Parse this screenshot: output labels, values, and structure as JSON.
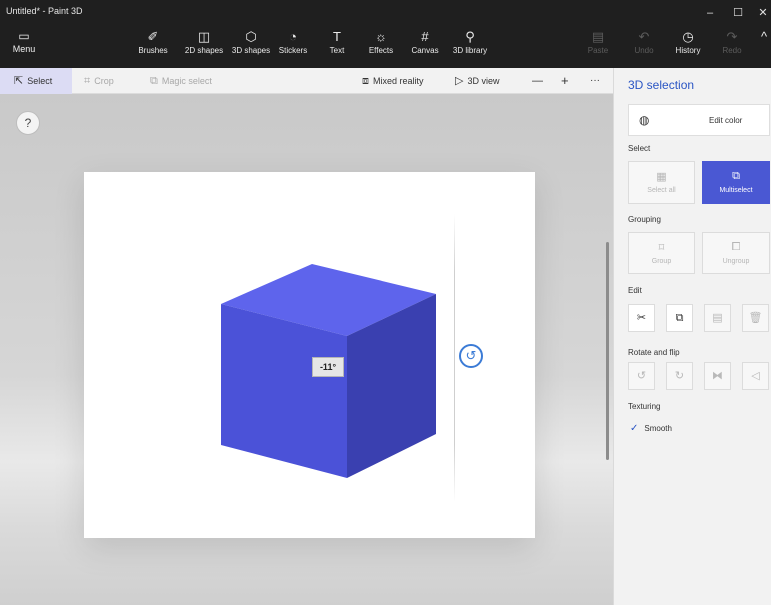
{
  "window": {
    "title": "Untitled* - Paint 3D",
    "minimize_icon": "minimize-icon",
    "maximize_icon": "maximize-icon",
    "close_icon": "close-icon"
  },
  "ribbon": {
    "menu_label": "Menu",
    "tools": [
      {
        "label": "Brushes",
        "icon": "brush-icon"
      },
      {
        "label": "2D shapes",
        "icon": "2d-shapes-icon"
      },
      {
        "label": "3D shapes",
        "icon": "3d-shapes-icon"
      },
      {
        "label": "Stickers",
        "icon": "stickers-icon"
      },
      {
        "label": "Text",
        "icon": "text-icon"
      },
      {
        "label": "Effects",
        "icon": "effects-icon"
      },
      {
        "label": "Canvas",
        "icon": "canvas-icon"
      },
      {
        "label": "3D library",
        "icon": "3d-library-icon"
      }
    ],
    "paste_label": "Paste",
    "undo_label": "Undo",
    "history_label": "History",
    "redo_label": "Redo"
  },
  "subtoolbar": {
    "select_label": "Select",
    "crop_label": "Crop",
    "magic_select_label": "Magic select",
    "mixed_reality_label": "Mixed reality",
    "view_3d_label": "3D view",
    "zoom_out": "—",
    "zoom_in": "+",
    "more": "···"
  },
  "canvas": {
    "help": "?",
    "angle": "-11°",
    "cube_colors": {
      "front": "#4b52d8",
      "top": "#5e64ec",
      "side": "#3a40b0"
    }
  },
  "panel": {
    "title": "3D selection",
    "edit_color_label": "Edit color",
    "select_section": "Select",
    "select_all_label": "Select all",
    "multiselect_label": "Multiselect",
    "grouping_section": "Grouping",
    "group_label": "Group",
    "ungroup_label": "Ungroup",
    "edit_section": "Edit",
    "rotate_section": "Rotate and flip",
    "texturing_section": "Texturing",
    "smooth_label": "Smooth"
  },
  "colors": {
    "accent": "#4a58d3",
    "title_blue": "#2a55c4",
    "dark_chrome": "#1f1f1f"
  }
}
